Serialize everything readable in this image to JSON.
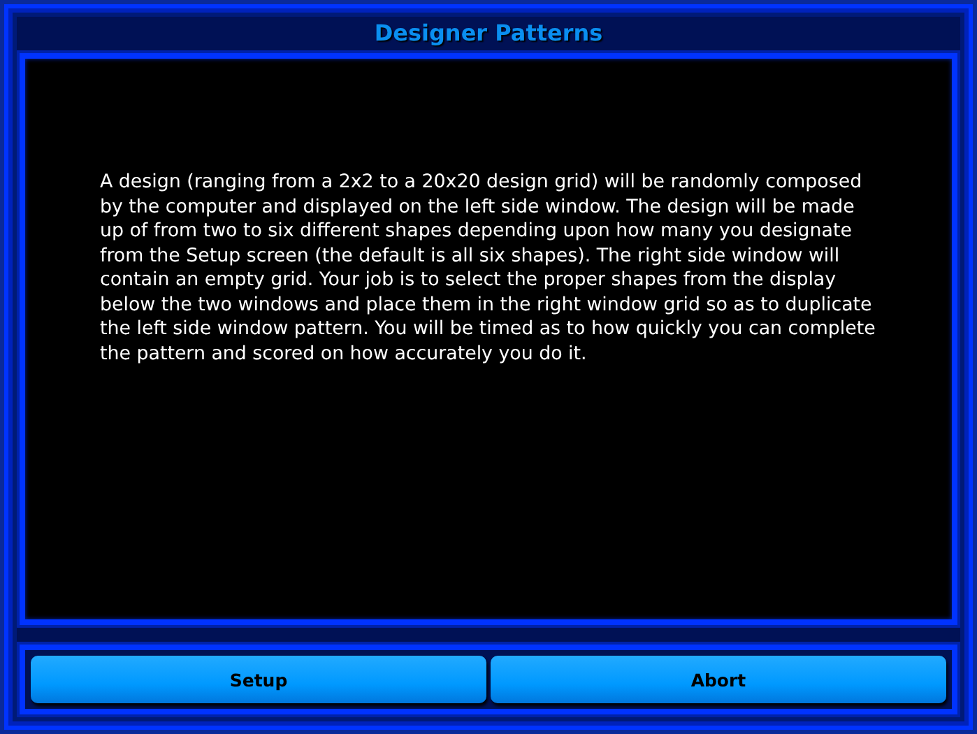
{
  "window": {
    "title": "Designer Patterns"
  },
  "instructions": "A design (ranging from a 2x2 to a 20x20 design grid) will be randomly composed by the computer and displayed on the left side window. The design will be made up of from two to six different shapes depending upon how many you designate from the Setup screen (the default is all six shapes). The right side window will contain an empty grid. Your job is to select the proper shapes from the display below the two windows and place them in the right window grid so as to duplicate the left side window pattern. You will be timed as to how quickly you can complete the pattern and scored on how accurately you do it.",
  "buttons": [
    {
      "label": "Setup"
    },
    {
      "label": "Abort"
    }
  ]
}
